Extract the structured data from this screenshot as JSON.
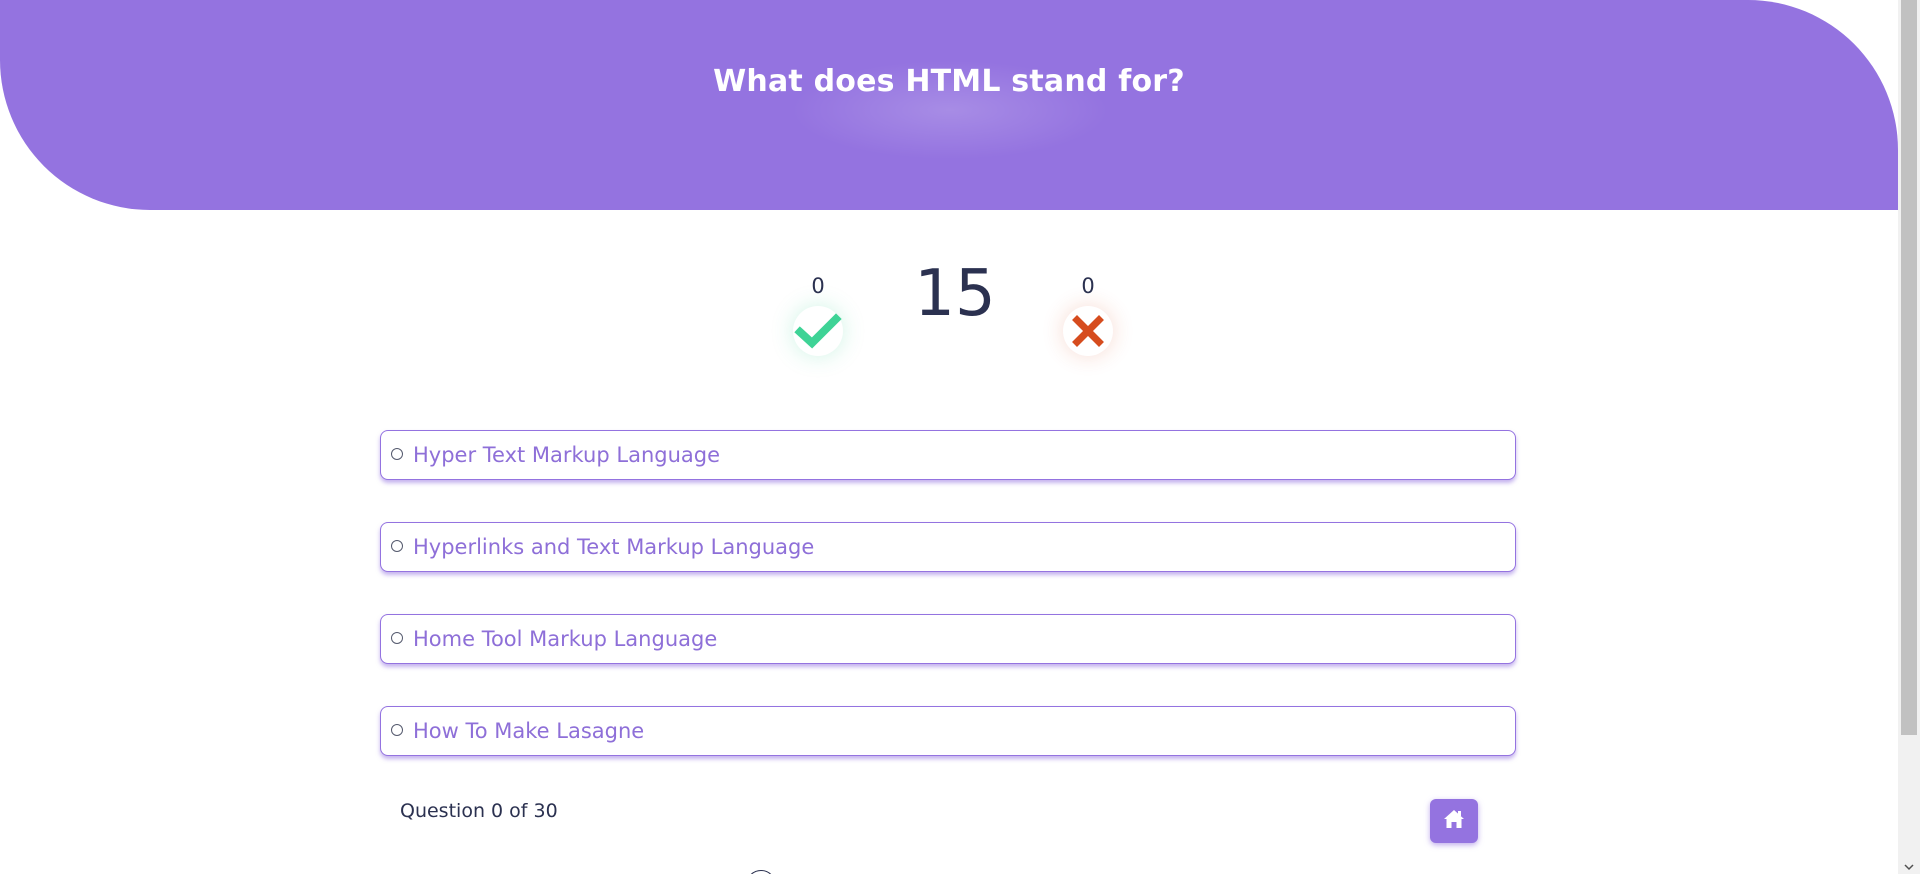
{
  "question": {
    "title": "What does HTML stand for?"
  },
  "score": {
    "correct": "0",
    "correct_icon": "check-icon",
    "wrong": "0",
    "wrong_icon": "cross-icon",
    "correct_color": "#3ed396",
    "wrong_color": "#d64c1e"
  },
  "timer": {
    "seconds": "15"
  },
  "answers": [
    {
      "label": "Hyper Text Markup Language"
    },
    {
      "label": "Hyperlinks and Text Markup Language"
    },
    {
      "label": "Home Tool Markup Language"
    },
    {
      "label": "How To Make Lasagne"
    }
  ],
  "progress": {
    "text": "Question 0 of 30"
  },
  "home_button": {
    "icon": "home-icon"
  },
  "colors": {
    "accent": "#9473e0",
    "text_dark": "#2b3150"
  }
}
